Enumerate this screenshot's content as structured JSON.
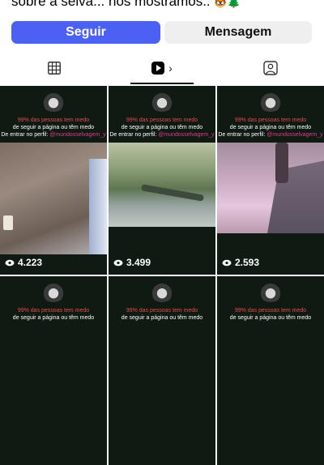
{
  "profile": {
    "bio_line": "sobre a selva... nos mostramos..",
    "bio_emojis": "🐯🌲"
  },
  "actions": {
    "follow_label": "Seguir",
    "message_label": "Mensagem"
  },
  "tabs": {
    "reels_chevron": "›"
  },
  "reels": [
    {
      "line1": "99% das pessoas tem medo",
      "line2": "de seguir a página ou têm medo",
      "line3_prefix": "De entrar no perfil: ",
      "handle": "@mundosselvagem_y",
      "views": "4.223"
    },
    {
      "line1": "99% das pessoas tem medo",
      "line2": "de seguir a página ou têm medo",
      "line3_prefix": "De entrar no perfil: ",
      "handle": "@mundosselvagem_y",
      "views": "3.499"
    },
    {
      "line1": "99% das pessoas tem medo",
      "line2": "de seguir a página ou têm medo",
      "line3_prefix": "De entrar no perfil: ",
      "handle": "@mundosselvagem_y",
      "views": "2.593"
    },
    {
      "line1": "99% das pessoas tem medo",
      "line2": "de seguir a página ou têm medo",
      "line3_prefix": "",
      "handle": "",
      "views": ""
    },
    {
      "line1": "99% das pessoas tem medo",
      "line2": "de seguir a página ou têm medo",
      "line3_prefix": "",
      "handle": "",
      "views": ""
    },
    {
      "line1": "99% das pessoas tem medo",
      "line2": "de seguir a página ou têm medo",
      "line3_prefix": "",
      "handle": "",
      "views": ""
    }
  ],
  "icons": {
    "grid": "grid-icon",
    "reels": "reels-icon",
    "tagged": "tagged-person-icon",
    "views": "eye-icon"
  }
}
